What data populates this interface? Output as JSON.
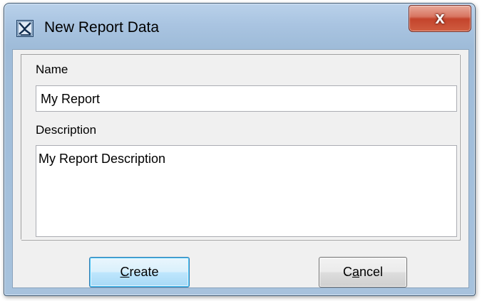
{
  "window": {
    "title": "New Report Data",
    "close_label": "x"
  },
  "form": {
    "name_label": "Name",
    "name_value": "My Report",
    "description_label": "Description",
    "description_value": "My Report Description"
  },
  "buttons": {
    "create_mnemonic": "C",
    "create_rest": "reate",
    "cancel_prefix": "C",
    "cancel_mnemonic": "a",
    "cancel_rest": "ncel"
  },
  "colors": {
    "frame": "#a9c4e1",
    "close_button": "#c4442c",
    "client": "#f0f0f0",
    "default_button_border": "#3c7fb1"
  },
  "icons": {
    "app": "report-data-icon",
    "close": "close-icon"
  }
}
